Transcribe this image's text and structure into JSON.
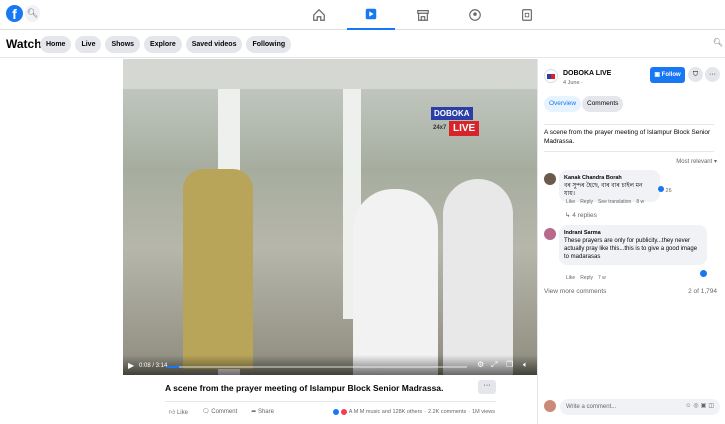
{
  "topbar": {
    "logo": "f",
    "search_icon": "search-icon",
    "nav": [
      {
        "icon": "home-icon"
      },
      {
        "icon": "watch-icon",
        "active": true
      },
      {
        "icon": "marketplace-icon"
      },
      {
        "icon": "groups-icon"
      },
      {
        "icon": "gaming-icon"
      }
    ]
  },
  "watch": {
    "title": "Watch",
    "pills": [
      "Home",
      "Live",
      "Shows",
      "Explore",
      "Saved videos",
      "Following"
    ]
  },
  "video": {
    "logo_top": "DOBOKA",
    "logo_live": "LIVE",
    "logo_sub": "24x7",
    "time": "0:08 / 3:14",
    "progress": 0.04,
    "title": "A scene from the prayer meeting of Islampur Block Senior Madrassa.",
    "more": "···",
    "actions": [
      "Like",
      "Comment",
      "Share"
    ],
    "reactions_text": "A M M music and 128K others",
    "comments": "2.2K comments",
    "views": "1M views"
  },
  "panel": {
    "page_name": "DOBOKA LIVE",
    "date": "4 June ·",
    "follow": "Follow",
    "more": "···",
    "tabs": [
      "Overview",
      "Comments"
    ],
    "description": "A scene from the prayer meeting of Islampur Block Senior Madrassa.",
    "sort": "Most relevant ▾",
    "comments": [
      {
        "name": "Kanak Chandra Borah",
        "text": "বৰ সুন্দৰ হৈছে, বাৰ বাৰ চাইল মন যায়।",
        "reactions": "26",
        "meta": [
          "Like",
          "Reply",
          "See translation",
          "8 w"
        ],
        "replies": "4 replies"
      },
      {
        "name": "Indrani Sarma",
        "text": "These prayers are only for publicity...they never actually pray like this...this is to give a good image to madarasas",
        "meta": [
          "Like",
          "Reply",
          "7 w"
        ]
      }
    ],
    "view_more": "View more comments",
    "count": "2 of 1,794",
    "write_placeholder": "Write a comment..."
  },
  "colors": {
    "accent": "#1877f2",
    "pill_bg": "#e4e6eb"
  }
}
